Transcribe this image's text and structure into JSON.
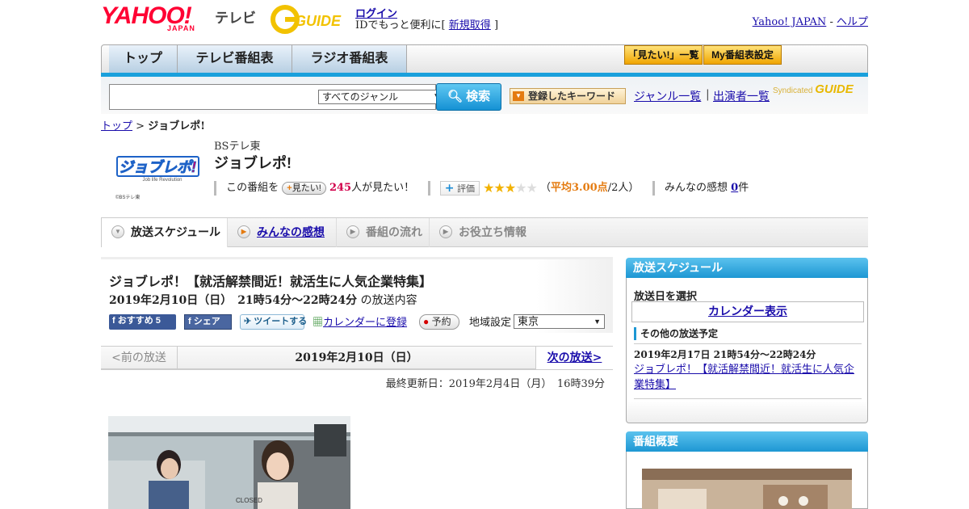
{
  "header": {
    "yahoo_logo": "YAHOO!",
    "yahoo_logo_sub": "JAPAN",
    "service_name": "テレビ",
    "gguide_logo": "GUIDE",
    "login": "ログイン",
    "id_note_prefix": "IDでもっと便利に[",
    "signup": "新規取得",
    "id_note_suffix": "]",
    "yahoo_japan_link": "Yahoo! JAPAN",
    "separator": "-",
    "help_link": "ヘルプ"
  },
  "nav": {
    "tabs": [
      "トップ",
      "テレビ番組表",
      "ラジオ番組表"
    ],
    "mitai_list": "「見たい!」一覧",
    "my_schedule": "My番組表設定"
  },
  "search": {
    "genre_selected": "すべてのジャンル",
    "button": "検索",
    "keyword_button": "登録したキーワード",
    "genre_list": "ジャンル一覧",
    "sep": "|",
    "cast_list": "出演者一覧",
    "syndicated": "Syndicated",
    "syndicated_logo": "GUIDE"
  },
  "breadcrumb": {
    "top": "トップ",
    "sep": ">",
    "current": "ジョブレポ!"
  },
  "program": {
    "logo_text": "ジョブレポ!",
    "logo_sub": "Job life Revolution",
    "logo_copyright": "©BSテレ東",
    "channel": "BSテレ東",
    "title": "ジョブレポ!",
    "mitai_prefix": "この番組を",
    "mitai_button": "見たい!",
    "mitai_count": "245",
    "mitai_suffix": "人が見たい！",
    "rating_button": "評価",
    "rating_value": 3,
    "rating_max": 5,
    "rating_open": "（",
    "rating_avg_label": "平均3.00点",
    "rating_people": "/2人）",
    "comments_label": "みんなの感想",
    "comments_count": "0",
    "comments_unit": "件"
  },
  "tabs": [
    {
      "label": "放送スケジュール",
      "state": "active"
    },
    {
      "label": "みんなの感想",
      "state": "link"
    },
    {
      "label": "番組の流れ",
      "state": "disabled"
    },
    {
      "label": "お役立ち情報",
      "state": "disabled"
    }
  ],
  "episode": {
    "title": "ジョブレポ！【就活解禁間近！就活生に人気企業特集】",
    "datetime": "2019年2月10日（日）　21時54分～22時24分",
    "datetime_suffix": "の放送内容",
    "fb_recommend": "おすすめ",
    "fb_recommend_count": "5",
    "fb_share": "シェア",
    "tweet": "ツイートする",
    "calendar": "カレンダーに登録",
    "reserve": "予約",
    "region_label": "地域設定",
    "region": "東京"
  },
  "date_nav": {
    "prev": "<前の放送",
    "current": "2019年2月10日（日）",
    "next": "次の放送>"
  },
  "updated": "最終更新日：2019年2月4日（月）　16時39分",
  "image_sign": "CLOSED",
  "sidebar": {
    "schedule_head": "放送スケジュール",
    "pick_date": "放送日を選択",
    "calendar_btn": "カレンダー表示",
    "other_head": "その他の放送予定",
    "other_date": "2019年2月17日  21時54分～22時24分",
    "other_title": "ジョブレポ！【就活解禁間近！就活生に人気企業特集】",
    "overview_head": "番組概要"
  },
  "colors": {
    "link": "#1a0dab",
    "accent_blue": "#1d97d3",
    "yahoo_red": "#ff0033",
    "star": "#f2b200",
    "pink": "#d2004b"
  }
}
